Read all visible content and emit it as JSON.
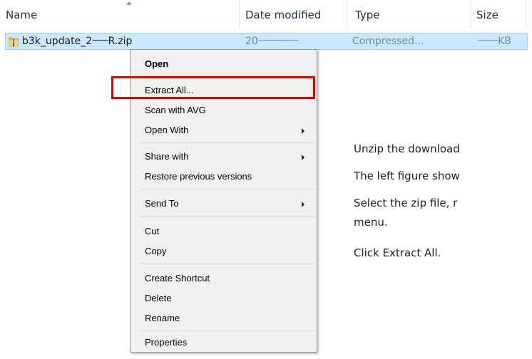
{
  "columns": {
    "name": "Name",
    "date": "Date modified",
    "type": "Type",
    "size": "Size"
  },
  "file": {
    "name_prefix": "b3k_update_2",
    "name_mask": "∼∼∼∼",
    "name_suffix": "R.zip",
    "date_prefix": "20",
    "date_mask": "∼∼∼∼∼∼∼∼∼∼",
    "type": "Compressed...",
    "size_mask": "∼∼∼∼∼",
    "size_unit": "KB",
    "icon": "zip-folder-icon"
  },
  "context_menu": {
    "items": [
      {
        "label": "Open",
        "bold": true
      },
      {
        "label": "Extract All..."
      },
      {
        "label": "Scan with AVG"
      },
      {
        "label": "Open With",
        "submenu": true
      },
      {
        "label": "Share with",
        "submenu": true
      },
      {
        "label": "Restore previous versions"
      },
      {
        "label": "Send To",
        "submenu": true
      },
      {
        "label": "Cut"
      },
      {
        "label": "Copy"
      },
      {
        "label": "Create Shortcut"
      },
      {
        "label": "Delete"
      },
      {
        "label": "Rename"
      },
      {
        "label": "Properties"
      }
    ]
  },
  "highlight_color": "#e00000",
  "notes": {
    "line1": "Unzip the download",
    "line2": "The left figure show",
    "line3a": "Select the zip file, r",
    "line3b": "menu.",
    "line4": "Click Extract All."
  }
}
